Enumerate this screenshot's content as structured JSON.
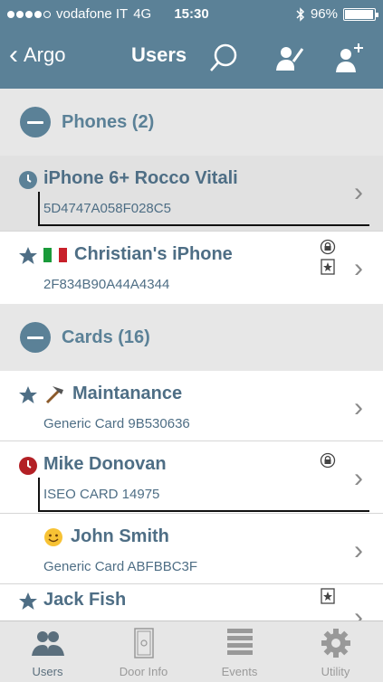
{
  "status_bar": {
    "carrier": "vodafone IT",
    "network": "4G",
    "time": "15:30",
    "battery": "96%",
    "battery_level": 0.96,
    "signal_bars": 4
  },
  "nav": {
    "back_label": "Argo",
    "title": "Users",
    "icons": [
      "search-icon",
      "edit-user-icon",
      "add-user-icon"
    ]
  },
  "sections": [
    {
      "label": "Phones (2)"
    },
    {
      "label": "Cards (16)"
    }
  ],
  "phones": [
    {
      "name": "iPhone 6+ Rocco Vitali",
      "id": "5D4747A058F028C5",
      "lead_icon": "clock-icon",
      "selected": true
    },
    {
      "name": "Christian's iPhone",
      "id": "2F834B90A44A4344",
      "lead_icon": "star-icon",
      "flag": "italy-flag-icon",
      "badges": [
        "lock-icon",
        "star-card-icon"
      ]
    }
  ],
  "cards": [
    {
      "name": "Maintanance",
      "id": "Generic Card 9B530636",
      "lead_icon": "star-icon",
      "emoji": "hammer-icon"
    },
    {
      "name": "Mike Donovan",
      "id": "ISEO CARD 14975",
      "lead_icon": "red-clock-icon",
      "badges": [
        "lock-icon"
      ]
    },
    {
      "name": "John Smith",
      "id": "Generic Card ABFBBC3F",
      "emoji": "smiley-icon"
    },
    {
      "name": "Jack Fish",
      "lead_icon": "star-icon",
      "badges": [
        "star-card-icon"
      ]
    }
  ],
  "tabs": [
    {
      "label": "Users",
      "icon": "users-icon",
      "active": true
    },
    {
      "label": "Door Info",
      "icon": "door-icon"
    },
    {
      "label": "Events",
      "icon": "list-icon"
    },
    {
      "label": "Utility",
      "icon": "gear-icon"
    }
  ],
  "colors": {
    "brand": "#5b8197",
    "text": "#4e6e85",
    "section_bg": "#e7e7e7",
    "alert_red": "#b32025"
  }
}
